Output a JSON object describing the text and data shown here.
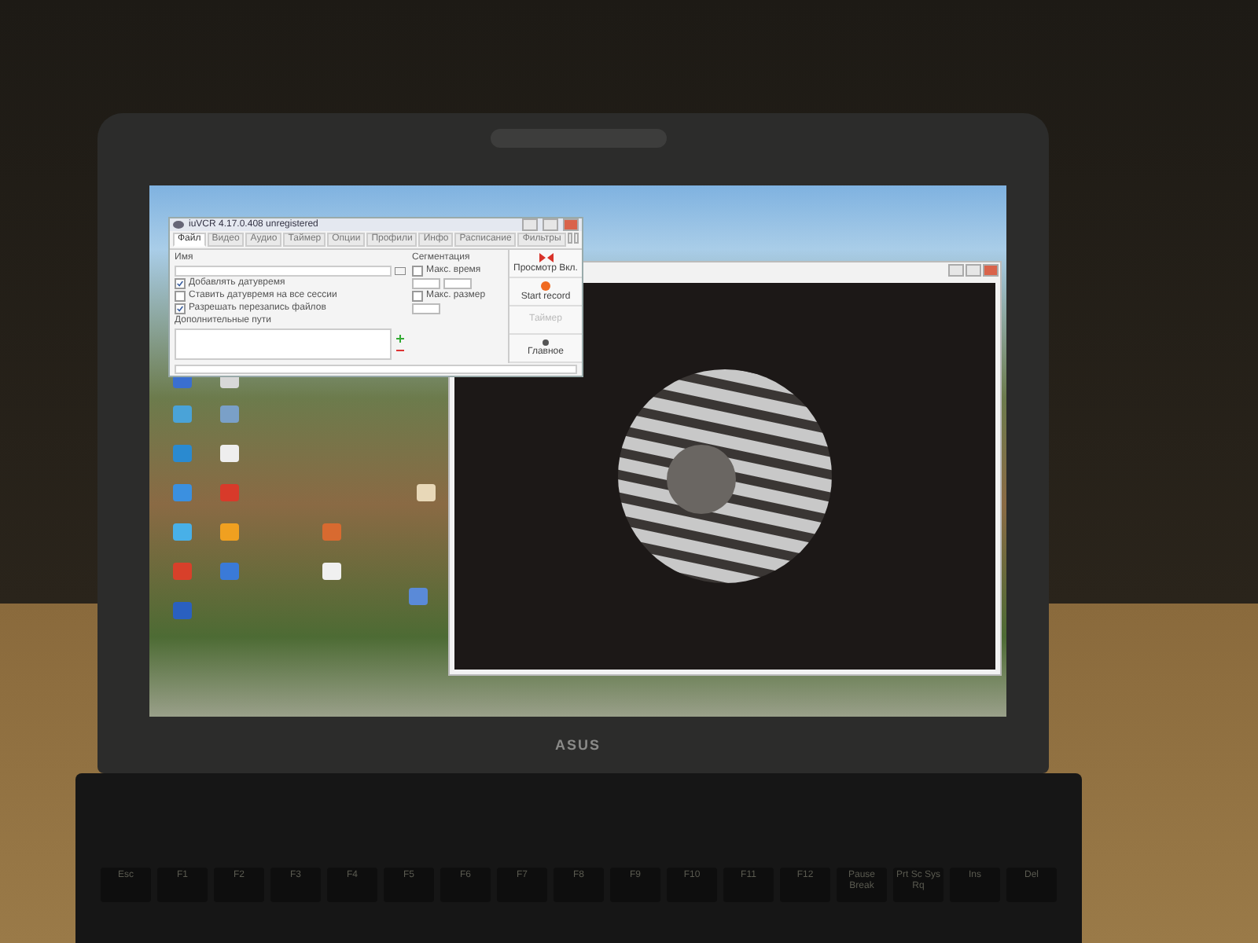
{
  "laptop": {
    "bezel_logo": "ASUS"
  },
  "vcr_window": {
    "title": "iuVCR 4.17.0.408 unregistered",
    "tabs": [
      {
        "label": "Файл",
        "selected": true
      },
      {
        "label": "Видео",
        "selected": false
      },
      {
        "label": "Аудио",
        "selected": false
      },
      {
        "label": "Таймер",
        "selected": false
      },
      {
        "label": "Опции",
        "selected": false
      },
      {
        "label": "Профили",
        "selected": false
      },
      {
        "label": "Инфо",
        "selected": false
      },
      {
        "label": "Расписание",
        "selected": false
      },
      {
        "label": "Фильтры",
        "selected": false
      }
    ],
    "file_panel": {
      "name_label": "Имя",
      "options": [
        {
          "label": "Добавлять датувремя",
          "checked": true
        },
        {
          "label": "Ставить датувремя на все сессии",
          "checked": false
        },
        {
          "label": "Разрешать перезапись файлов",
          "checked": true
        }
      ],
      "extra_paths_label": "Дополнительные пути"
    },
    "segmentation": {
      "label": "Сегментация",
      "options": [
        {
          "label": "Макс. время",
          "checked": false
        },
        {
          "label": "Макс. размер",
          "checked": false
        }
      ]
    },
    "side_buttons": [
      {
        "kind": "preview",
        "label": "Просмотр Вкл.",
        "disabled": false
      },
      {
        "kind": "record",
        "label": "Start record",
        "disabled": false
      },
      {
        "kind": "timer",
        "label": "Таймер",
        "disabled": true
      },
      {
        "kind": "main",
        "label": "Главное",
        "disabled": false
      }
    ]
  },
  "keyboard": {
    "keys": [
      "Esc",
      "F1",
      "F2",
      "F3",
      "F4",
      "F5",
      "F6",
      "F7",
      "F8",
      "F9",
      "F10",
      "F11",
      "F12",
      "Pause Break",
      "Prt Sc Sys Rq",
      "Ins",
      "Del"
    ]
  }
}
